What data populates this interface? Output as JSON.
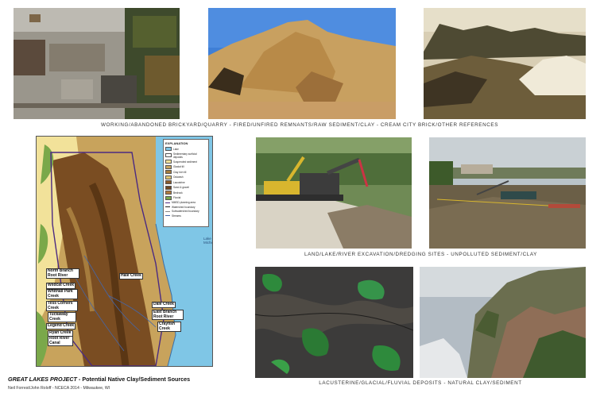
{
  "captions": {
    "row1": "WORKING/ABANDONED BRICKYARD/QUARRY - FIRED/UNFIRED REMNANTS/RAW SEDIMENT/CLAY - CREAM CITY BRICK/OTHER REFERENCES",
    "row2": "LAND/LAKE/RIVER EXCAVATION/DREDGING SITES - UNPOLLUTED SEDIMENT/CLAY",
    "row3": "LACUSTERINE/GLACIAL/FLUVIAL DEPOSITS - NATURAL CLAY/SEDIMENT"
  },
  "map": {
    "legend_title": "EXPLANATION",
    "legend_items": [
      {
        "label": "Lake",
        "color": "#7fc6e6"
      },
      {
        "label": "Sedimentary surficial deposits",
        "color": "#ffffff"
      },
      {
        "label": "Suspended sediment",
        "color": "#f2e29a"
      },
      {
        "label": "Glacial till",
        "color": "#c8a35c"
      },
      {
        "label": "Clay rich till",
        "color": "#a67c3d"
      },
      {
        "label": "Outwash",
        "color": "#e0c36f"
      },
      {
        "label": "Lacustrine",
        "color": "#8a5a2b"
      },
      {
        "label": "Sand & gravel",
        "color": "#6f4721"
      },
      {
        "label": "Bedrock",
        "color": "#b07a3e"
      },
      {
        "label": "Fluvial",
        "color": "#7aa84a"
      }
    ],
    "legend_lines": [
      "MMSD planning area",
      "Watershed boundary",
      "Subwatershed boundary",
      "Streams"
    ],
    "lake_label": "Lake\nMichigan",
    "creeks": [
      "North Branch Root River",
      "Wildcat Creek",
      "Whitnall Park Creek",
      "Tess Corners Creek",
      "Tuckaway Creek",
      "Legend Creek",
      "Ryan Creek",
      "Root River Canal",
      "Hale Creek",
      "Dale Creek",
      "East Branch Root River",
      "Crayfish Creek"
    ]
  },
  "footer": {
    "title_italic": "GREAT LAKES PROJECT",
    "title_rest": " - Potential Native Clay/Sediment Sources",
    "credit": "Neil Forrest/John Roloff - NCECA 2014 - Milwaukee, WI"
  }
}
